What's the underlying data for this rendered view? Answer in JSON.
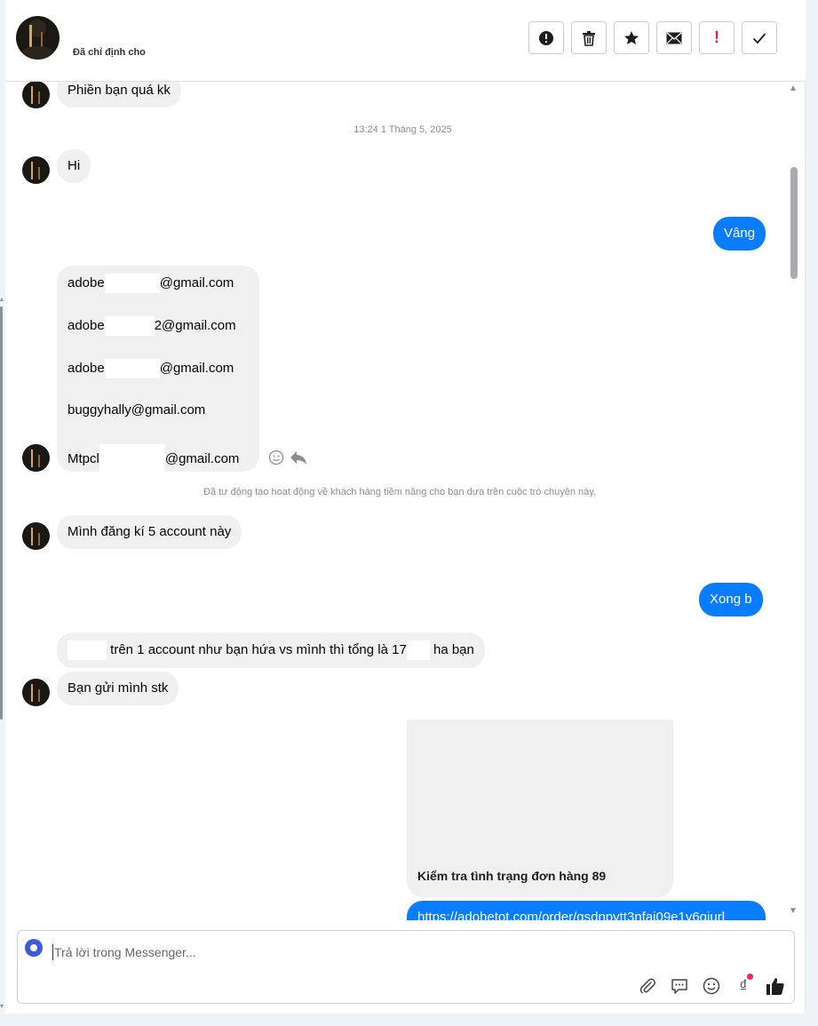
{
  "header": {
    "assigned_label": "Đã chỉ định cho",
    "toolbar": [
      {
        "name": "spam-button",
        "icon": "exclamation-circle-icon",
        "glyph": "!"
      },
      {
        "name": "delete-button",
        "icon": "trash-icon",
        "glyph": "🗑"
      },
      {
        "name": "star-button",
        "icon": "star-icon",
        "glyph": "★"
      },
      {
        "name": "mark-unread-button",
        "icon": "envelope-icon",
        "glyph": "✉"
      },
      {
        "name": "follow-up-button",
        "icon": "red-exclamation-icon",
        "glyph": "!"
      },
      {
        "name": "mark-done-button",
        "icon": "check-icon",
        "glyph": "✓"
      }
    ]
  },
  "messages": {
    "m1": "Phiền bạn quá kk",
    "timestamp": "13:24 1 Tháng 5, 2025",
    "m2": "Hi",
    "m3": "Vâng",
    "emails": {
      "e1_prefix": "adobe",
      "e1_suffix": "@gmail.com",
      "e2_prefix": "adobe",
      "e2_suffix": "2@gmail.com",
      "e3_prefix": "adobe",
      "e3_suffix": "@gmail.com",
      "e4": "buggyhally@gmail.com",
      "e5_prefix": "Mtpcl",
      "e5_suffix": "@gmail.com"
    },
    "system_note": "Đã tự động tạo hoạt động về khách hàng tiềm năng cho bạn dựa trên cuộc trò chuyện này.",
    "m4": "Mình đăng kí 5 account này",
    "m5": "Xong b",
    "m6_mid": "trên 1 account như bạn hứa vs mình thì tổng là 17",
    "m6_end": "ha bạn",
    "m7": "Bạn gửi mình stk",
    "card_title": "Kiểm tra tình trạng đơn hàng 89",
    "link": "https://adobetot.com/order/gsdnpvtt3nfai09e1y6giurl"
  },
  "composer": {
    "placeholder": "Trả lời trong Messenger..."
  },
  "colors": {
    "outgoing": "#0a7cff",
    "incoming": "#f0f0f0",
    "alert_red": "#e41e3f"
  }
}
